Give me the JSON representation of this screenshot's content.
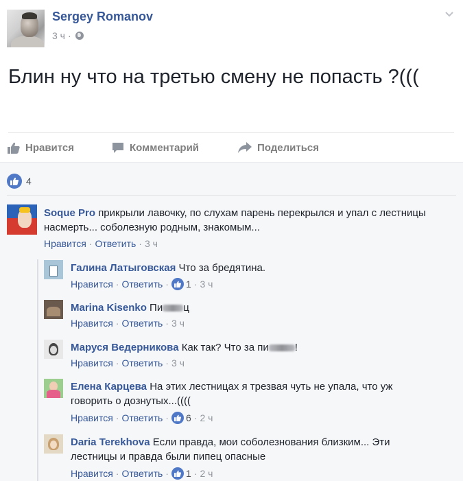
{
  "post": {
    "author": "Sergey Romanov",
    "time": "3 ч",
    "meta_sep": "·",
    "text": "Блин ну что на третью смену не попасть ?((("
  },
  "actions": {
    "like": "Нравится",
    "comment": "Комментарий",
    "share": "Поделиться"
  },
  "reactions": {
    "count": "4"
  },
  "comments": [
    {
      "author": "Soque Pro",
      "text": "прикрыли лавочку, по слухам парень перекрылся и упал с лестницы насмерть... соболезную родным, знакомым...",
      "like": "Нравится",
      "reply": "Ответить",
      "time": "3 ч",
      "likes": ""
    }
  ],
  "replies": [
    {
      "author": "Галина Латыговская",
      "text": "Что за бредятина.",
      "like": "Нравится",
      "reply": "Ответить",
      "likes": "1",
      "time": "3 ч"
    },
    {
      "author": "Marina Kisenko",
      "text_start": "Пи",
      "text_end": "ц",
      "like": "Нравится",
      "reply": "Ответить",
      "time": "3 ч"
    },
    {
      "author": "Маруся Ведерникова",
      "text_start": "Как так? Что за пи",
      "text_end": "!",
      "like": "Нравится",
      "reply": "Ответить",
      "time": "3 ч"
    },
    {
      "author": "Елена Карцева",
      "text": "На этих лестницах я трезвая чуть не упала, что уж говорить о дознутых...((((",
      "like": "Нравится",
      "reply": "Ответить",
      "likes": "6",
      "time": "2 ч"
    },
    {
      "author": "Daria Terekhova",
      "text": "Если правда, мои соболезнования близким... Эти лестницы и правда были пипец опасные",
      "like": "Нравится",
      "reply": "Ответить",
      "likes": "1",
      "time": "2 ч"
    }
  ],
  "sep": "·",
  "colors": {
    "link": "#365899",
    "meta": "#90949c",
    "like_badge": "#4f78c7",
    "comments_bg": "#f6f7f9"
  }
}
